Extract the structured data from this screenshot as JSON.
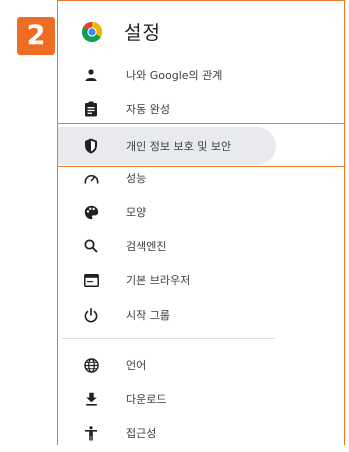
{
  "step_badge": "2",
  "header": {
    "title": "설정",
    "logo_icon": "chrome-logo-icon"
  },
  "menu": {
    "items": [
      {
        "label": "나와 Google의 관계",
        "icon": "person-icon"
      },
      {
        "label": "자동 완성",
        "icon": "clipboard-icon"
      },
      {
        "label": "개인 정보 보호 및 보안",
        "icon": "shield-icon",
        "selected": true
      },
      {
        "label": "성능",
        "icon": "speedometer-icon"
      },
      {
        "label": "모양",
        "icon": "palette-icon"
      },
      {
        "label": "검색엔진",
        "icon": "search-icon"
      },
      {
        "label": "기본 브라우저",
        "icon": "browser-window-icon"
      },
      {
        "label": "시작 그룹",
        "icon": "power-icon"
      },
      {
        "label": "언어",
        "icon": "globe-icon"
      },
      {
        "label": "다운로드",
        "icon": "download-icon"
      },
      {
        "label": "접근성",
        "icon": "accessibility-icon"
      }
    ]
  },
  "colors": {
    "accent_orange": "#ea7b2c",
    "selected_bg": "#e8eaed",
    "text": "#3c4043"
  }
}
